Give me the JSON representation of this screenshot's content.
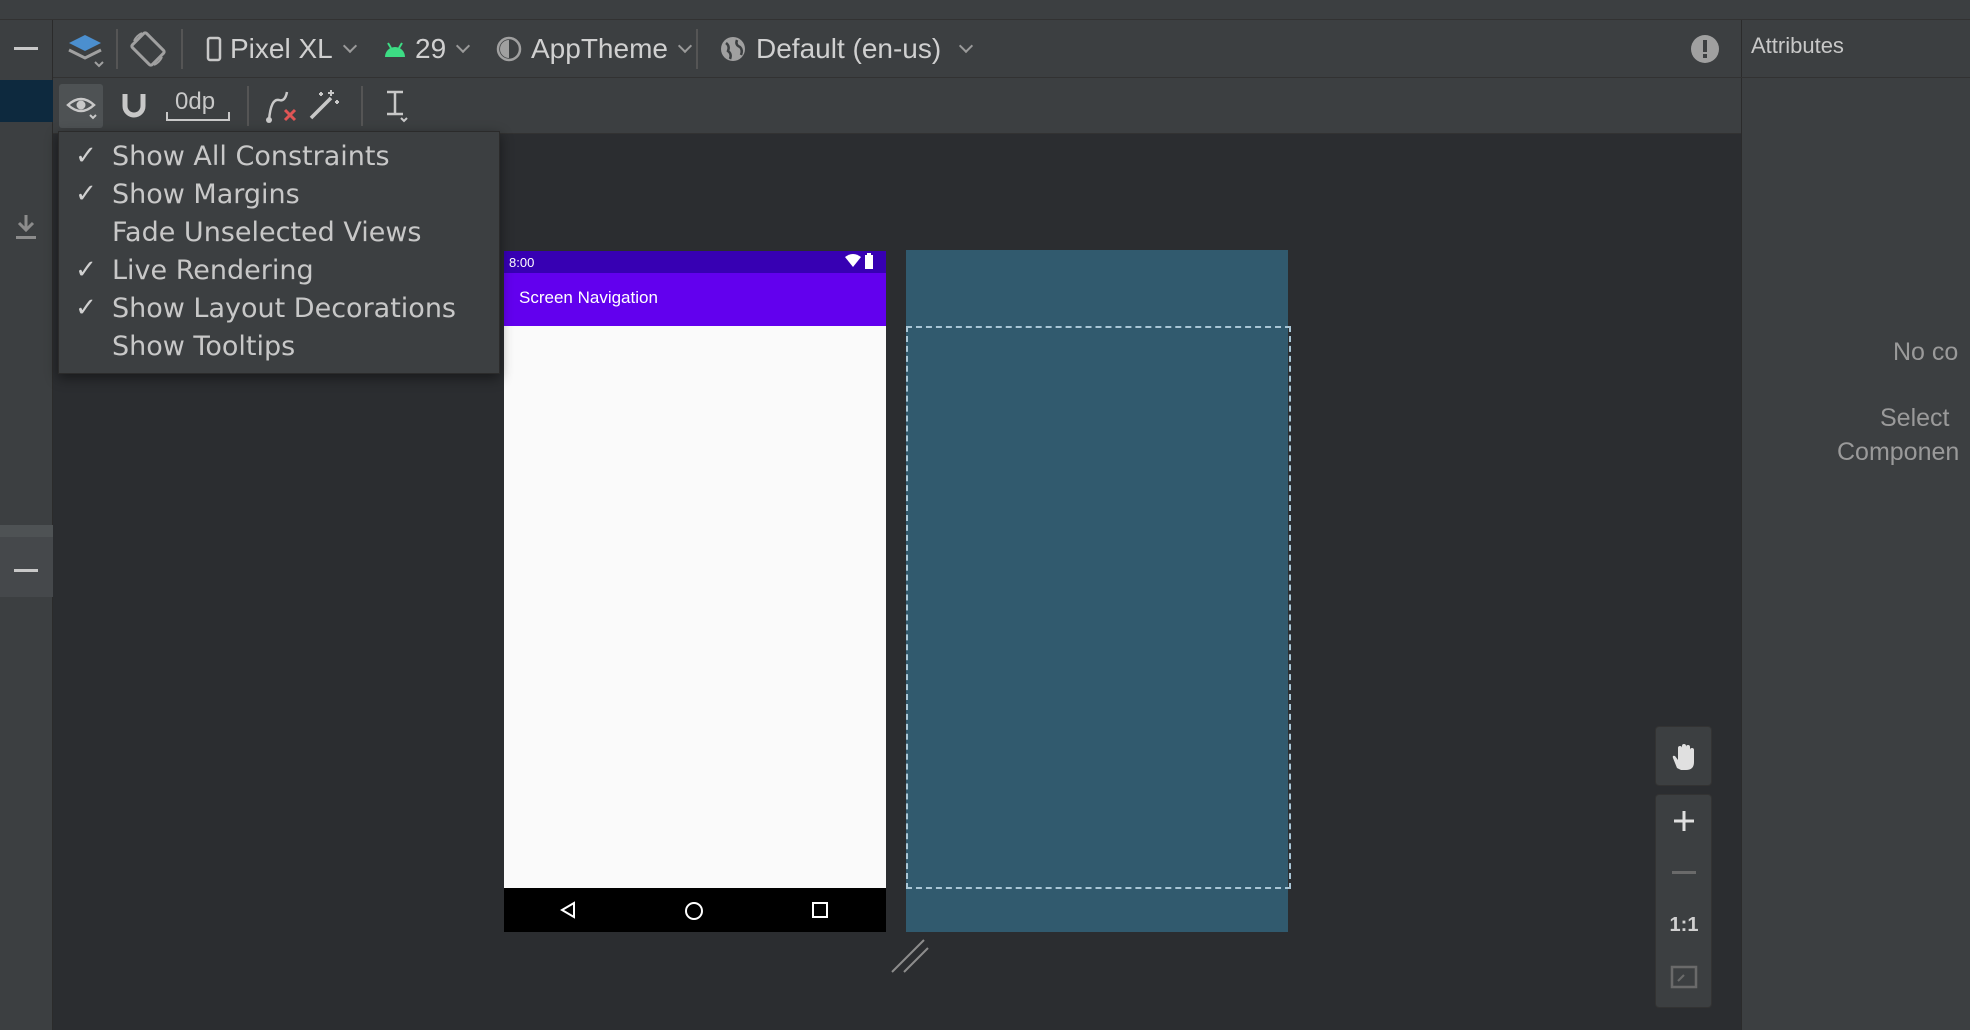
{
  "toolbar": {
    "device": "Pixel XL",
    "api_level": "29",
    "theme": "AppTheme",
    "locale": "Default (en-us)",
    "margin_value": "0dp"
  },
  "attributes": {
    "title": "Attributes",
    "message_line1": "No co",
    "message_line2": "Select",
    "message_line3": "Componen"
  },
  "view_menu": {
    "items": [
      {
        "label": "Show All Constraints",
        "checked": true,
        "check_mark": "✓"
      },
      {
        "label": "Show Margins",
        "checked": true,
        "check_mark": "✓"
      },
      {
        "label": "Fade Unselected Views",
        "checked": false,
        "check_mark": ""
      },
      {
        "label": "Live Rendering",
        "checked": true,
        "check_mark": "✓"
      },
      {
        "label": "Show Layout Decorations",
        "checked": true,
        "check_mark": "✓"
      },
      {
        "label": "Show Tooltips",
        "checked": false,
        "check_mark": ""
      }
    ]
  },
  "phone": {
    "time": "8:00",
    "app_title": "Screen Navigation"
  },
  "zoom": {
    "actual_size_label": "1:1"
  },
  "colors": {
    "primary": "#6200ee",
    "primary_dark": "#3700b3",
    "blueprint": "#315a6e",
    "panel": "#3c3f41",
    "canvas": "#2b2d30"
  }
}
